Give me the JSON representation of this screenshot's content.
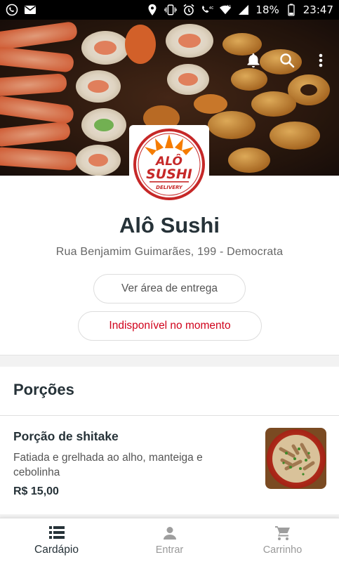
{
  "status_bar": {
    "battery": "18%",
    "time": "23:47",
    "network_label": "4G",
    "left_icons": [
      "whatsapp-icon",
      "gmail-icon"
    ],
    "right_icons": [
      "location-icon",
      "vibrate-icon",
      "alarm-icon",
      "call-icon",
      "wifi-icon",
      "signal-icon",
      "battery-icon"
    ]
  },
  "header_actions": [
    "bell-icon",
    "search-icon",
    "more-vert-icon"
  ],
  "logo": {
    "line1": "ALÔ",
    "line2": "SUSHI",
    "line3": "DELIVERY",
    "brand_color": "#c62828",
    "accent_color": "#f57c00"
  },
  "store": {
    "name": "Alô Sushi",
    "address": "Rua Benjamim Guimarães, 199 - Democrata",
    "delivery_area_label": "Ver área de entrega",
    "availability_label": "Indisponível no momento",
    "availability_color": "#d0021b"
  },
  "menu": {
    "section_title": "Porções",
    "items": [
      {
        "name": "Porção de shitake",
        "description": "Fatiada e grelhada ao alho, manteiga e cebolinha",
        "price": "R$ 15,00"
      }
    ]
  },
  "bottom_nav": [
    {
      "label": "Cardápio",
      "icon": "menu-list-icon",
      "active": true
    },
    {
      "label": "Entrar",
      "icon": "person-icon",
      "active": false
    },
    {
      "label": "Carrinho",
      "icon": "cart-icon",
      "active": false
    }
  ]
}
